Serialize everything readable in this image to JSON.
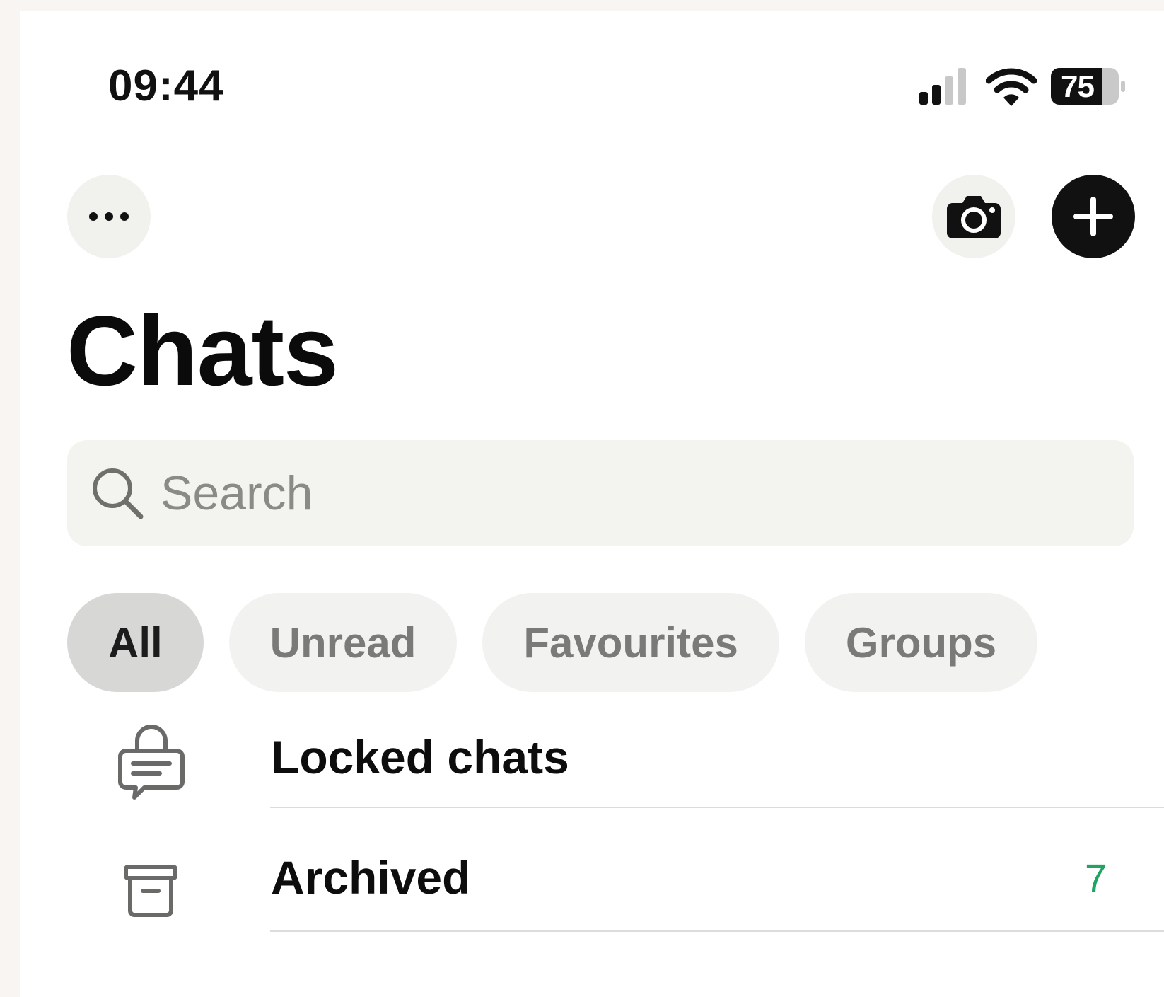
{
  "status_bar": {
    "time": "09:44",
    "battery": "75"
  },
  "header": {
    "title": "Chats"
  },
  "search": {
    "placeholder": "Search"
  },
  "filters": [
    {
      "label": "All",
      "active": true
    },
    {
      "label": "Unread",
      "active": false
    },
    {
      "label": "Favourites",
      "active": false
    },
    {
      "label": "Groups",
      "active": false
    }
  ],
  "rows": [
    {
      "label": "Locked chats",
      "icon": "locked-chat-icon",
      "count": ""
    },
    {
      "label": "Archived",
      "icon": "archive-icon",
      "count": "7"
    }
  ],
  "colors": {
    "accent_green": "#1fa463",
    "primary_dark": "#111111"
  }
}
